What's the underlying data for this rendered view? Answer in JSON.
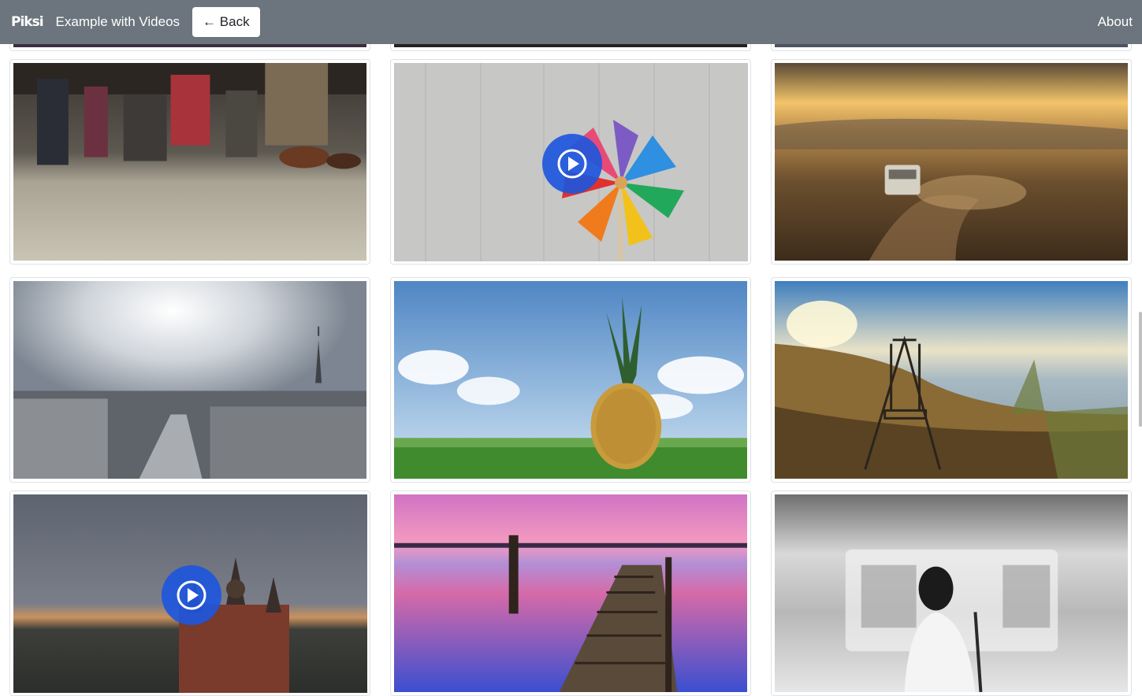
{
  "navbar": {
    "brand": "Piksi",
    "title": "Example with Videos",
    "back_label": "← Back",
    "about_label": "About",
    "background": "#6c757d"
  },
  "gallery": {
    "items": [
      {
        "subject": "commuter feet on train floor",
        "type": "image"
      },
      {
        "subject": "colorful pinwheel on wood",
        "type": "video"
      },
      {
        "subject": "van on desert road at sunset",
        "type": "image"
      },
      {
        "subject": "Paris skyline with Eiffel Tower",
        "type": "image"
      },
      {
        "subject": "pineapple in grass field",
        "type": "image"
      },
      {
        "subject": "swing by the lake at sunset",
        "type": "image"
      },
      {
        "subject": "church at dusk",
        "type": "video"
      },
      {
        "subject": "wooden pier at pink sunset",
        "type": "image"
      },
      {
        "subject": "woman at subway platform",
        "type": "image"
      }
    ]
  },
  "colors": {
    "play_button": "#1e56dc"
  }
}
